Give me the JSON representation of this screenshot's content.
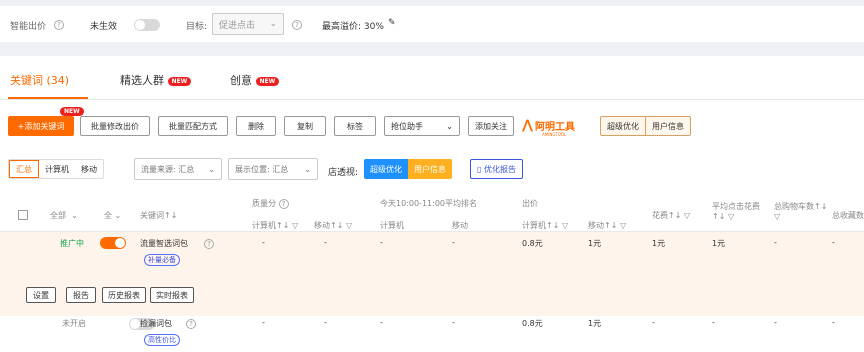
{
  "top": {
    "smart_bid_label": "智能出价",
    "not_active_label": "未生效",
    "target_label": "目标:",
    "target_value": "促进点击",
    "max_premium": "最高溢价: 30%"
  },
  "tabs": [
    {
      "label": "关键词 (34)"
    },
    {
      "label": "精选人群",
      "badge": "NEW"
    },
    {
      "label": "创意",
      "badge": "NEW"
    }
  ],
  "toolbar": {
    "add_keyword": "+添加关键词",
    "add_keyword_badge": "NEW",
    "batch_bid": "批量修改出价",
    "batch_match": "批量匹配方式",
    "delete": "删除",
    "copy": "复制",
    "tag": "标签",
    "rank_helper": "抢位助手",
    "add_follow": "添加关注",
    "brand": "阿明工具",
    "brand_sub": "AMINGTOOL",
    "super_opt": "超级优化",
    "user_info": "用户信息"
  },
  "filters": {
    "segment": [
      "汇总",
      "计算机",
      "移动"
    ],
    "traffic_source": "流量来源: 汇总",
    "display_position": "展示位置: 汇总",
    "perspective_label": "店透视:",
    "perspective_super": "超级优化",
    "perspective_user": "用户信息",
    "report_link": "优化报告"
  },
  "table": {
    "headers": {
      "all1": "全部",
      "all2": "全",
      "keyword": "关键词↑↓",
      "quality": "质量分",
      "rank": "今天10:00-11:00平均排名",
      "bid": "出价",
      "pc1": "计算机↑↓",
      "mobile1": "移动↑↓",
      "pc2": "计算机",
      "mobile2": "移动",
      "pc3": "计算机↑↓",
      "mobile3": "移动↑↓",
      "cost": "花费↑↓",
      "avg_cost_1": "平均点击花费",
      "avg_cost_2": "↑↓",
      "cart_1": "总购物车数↑↓",
      "fav": "总收藏数"
    },
    "rows": [
      {
        "status": "推广中",
        "on": true,
        "keyword": "流量智选词包",
        "tag": "补量必备",
        "q_pc": "-",
        "q_mobile": "-",
        "r_pc": "-",
        "r_mobile": "-",
        "bid_pc": "0.8元",
        "bid_mobile": "1元",
        "cost": "1元",
        "avg": "1元",
        "cart": "-",
        "fav": "-"
      },
      {
        "status": "未开启",
        "on": false,
        "keyword": "捡漏词包",
        "tag": "高性价比",
        "q_pc": "-",
        "q_mobile": "-",
        "r_pc": "-",
        "r_mobile": "-",
        "bid_pc": "0.8元",
        "bid_mobile": "1元",
        "cost": "-",
        "avg": "-",
        "cart": "-",
        "fav": "-"
      }
    ],
    "row_actions": [
      "设置",
      "报告",
      "历史报表",
      "实时报表"
    ]
  }
}
